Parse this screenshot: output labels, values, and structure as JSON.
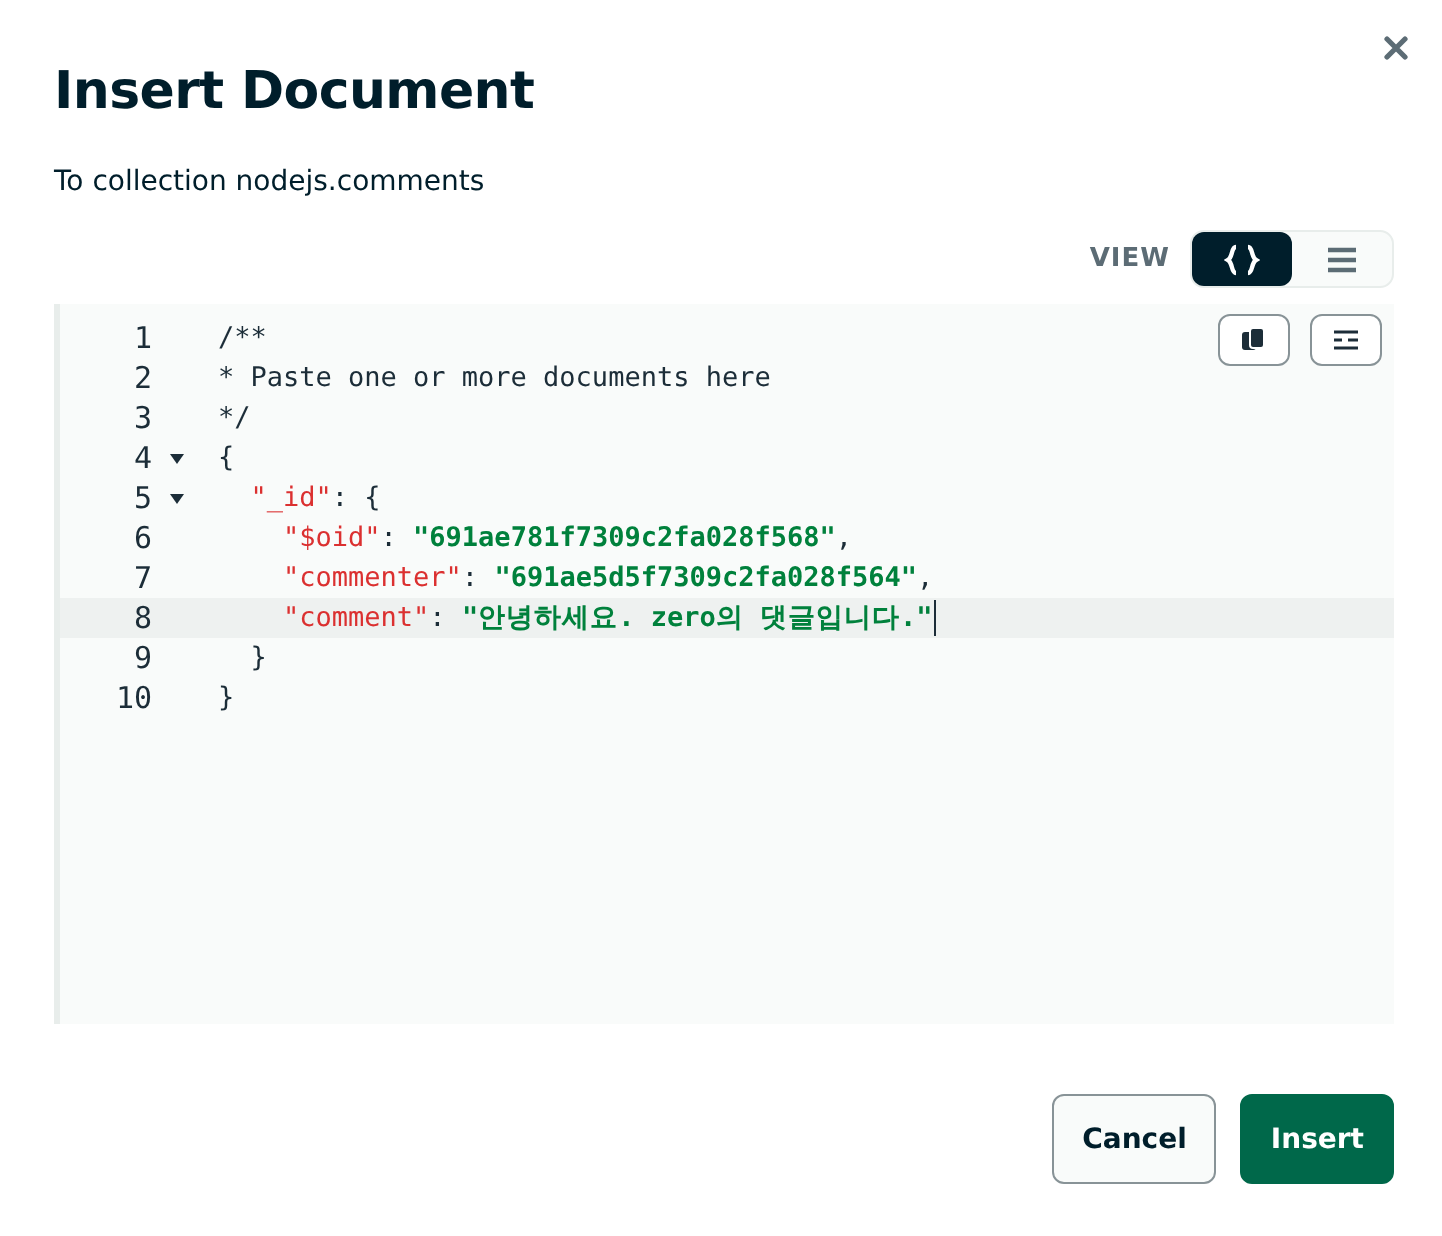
{
  "dialog": {
    "title": "Insert Document",
    "subtitle": "To collection nodejs.comments"
  },
  "view": {
    "label": "VIEW",
    "options": [
      {
        "kind": "json",
        "selected": true
      },
      {
        "kind": "list",
        "selected": false
      }
    ]
  },
  "editor": {
    "lines": [
      {
        "number": "1",
        "active": false,
        "tokens": [
          {
            "kind": "comment",
            "text": "/**"
          }
        ]
      },
      {
        "number": "2",
        "active": false,
        "tokens": [
          {
            "kind": "comment",
            "text": "* Paste one or more documents here"
          }
        ]
      },
      {
        "number": "3",
        "active": false,
        "tokens": [
          {
            "kind": "comment",
            "text": "*/"
          }
        ]
      },
      {
        "number": "4",
        "active": false,
        "expanded": true,
        "tokens": [
          {
            "kind": "punct",
            "text": "{"
          }
        ]
      },
      {
        "number": "5",
        "active": false,
        "expanded": true,
        "tokens": [
          {
            "kind": "key",
            "text": "  \"_id\""
          },
          {
            "kind": "punct",
            "text": ": {"
          }
        ]
      },
      {
        "number": "6",
        "active": false,
        "tokens": [
          {
            "kind": "key",
            "text": "    \"$oid\""
          },
          {
            "kind": "punct",
            "text": ": "
          },
          {
            "kind": "string",
            "text": "\"691ae781f7309c2fa028f568\""
          },
          {
            "kind": "punct",
            "text": ","
          }
        ]
      },
      {
        "number": "7",
        "active": false,
        "tokens": [
          {
            "kind": "key",
            "text": "    \"commenter\""
          },
          {
            "kind": "punct",
            "text": ": "
          },
          {
            "kind": "string",
            "text": "\"691ae5d5f7309c2fa028f564\""
          },
          {
            "kind": "punct",
            "text": ","
          }
        ]
      },
      {
        "number": "8",
        "active": true,
        "tokens": [
          {
            "kind": "key",
            "text": "    \"comment\""
          },
          {
            "kind": "punct",
            "text": ": "
          },
          {
            "kind": "string",
            "text": "\"안녕하세요. zero의 댓글입니다.\""
          }
        ]
      },
      {
        "number": "9",
        "active": false,
        "tokens": [
          {
            "kind": "punct",
            "text": "  }"
          }
        ]
      },
      {
        "number": "10",
        "active": false,
        "tokens": [
          {
            "kind": "punct",
            "text": "}"
          }
        ]
      }
    ]
  },
  "buttons": [
    {
      "kind": "secondary",
      "label": "Cancel"
    },
    {
      "kind": "primary",
      "label": "Insert"
    }
  ]
}
